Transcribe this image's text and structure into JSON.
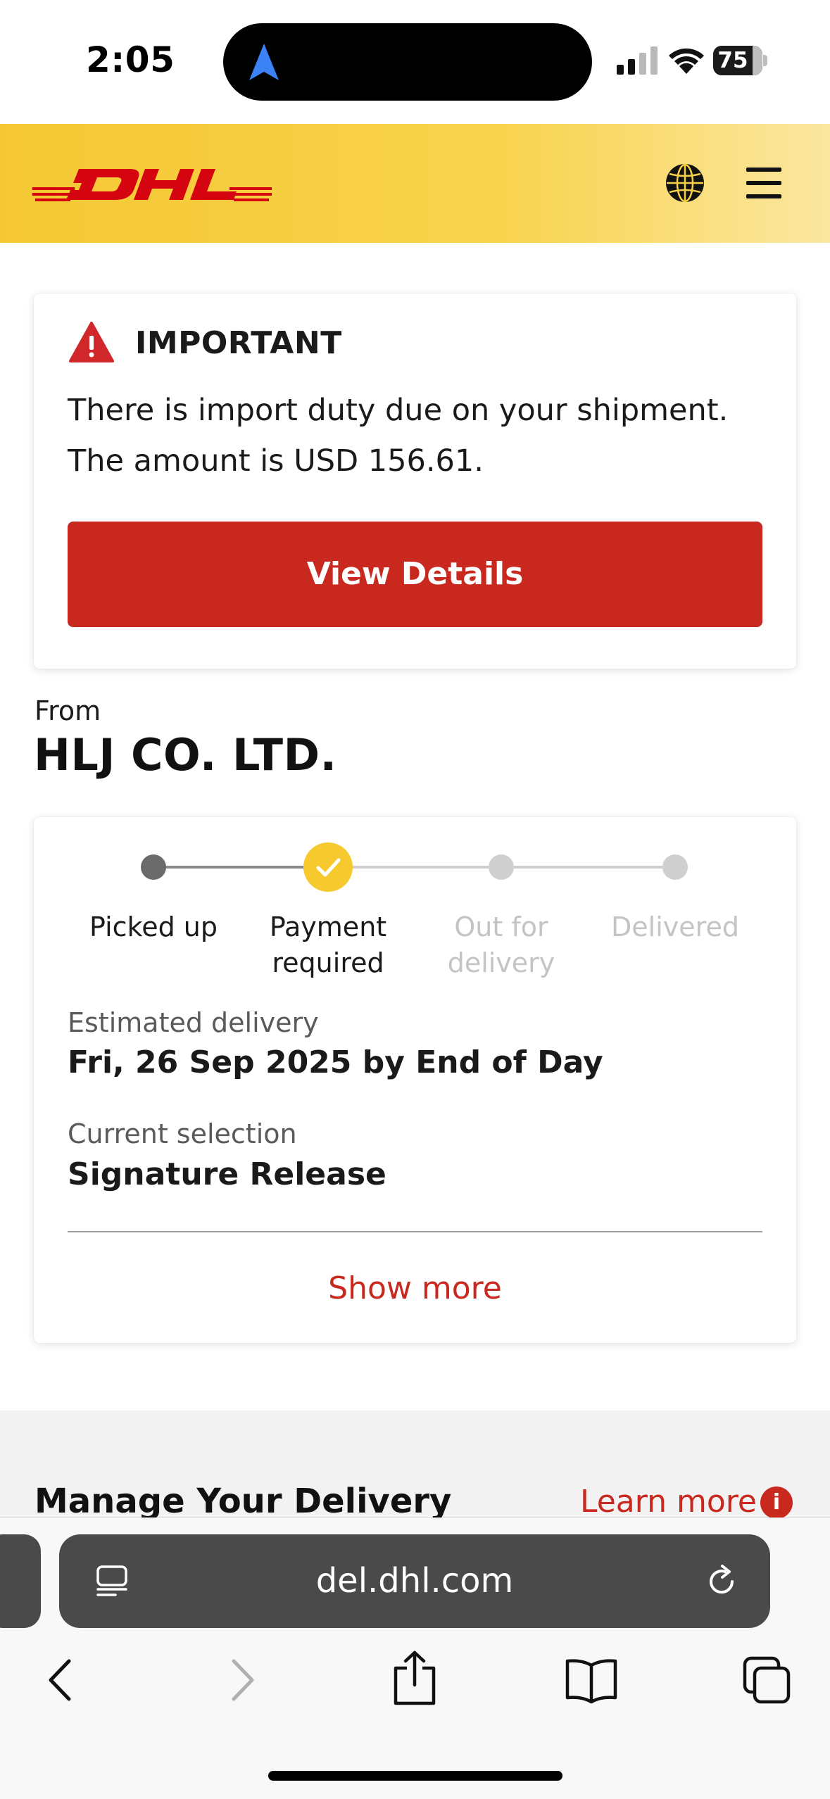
{
  "status_bar": {
    "time": "2:05",
    "battery_percent": "75",
    "battery_level": 0.75,
    "icons": [
      "navigation-arrow-icon",
      "cellular-signal-icon",
      "wifi-icon",
      "battery-icon"
    ]
  },
  "header": {
    "logo_text": "DHL",
    "brand_yellow": "#f5c833",
    "brand_red": "#c8281e",
    "icons": [
      "globe-icon",
      "menu-icon"
    ]
  },
  "alert": {
    "title": "IMPORTANT",
    "message": "There is import duty due on your shipment. The amount is USD 156.61.",
    "button_label": "View Details",
    "icon": "warning-icon"
  },
  "shipment": {
    "from_label": "From",
    "from_name": "HLJ CO. LTD."
  },
  "progress": {
    "steps": [
      {
        "label": "Picked up",
        "state": "completed"
      },
      {
        "label": "Payment required",
        "state": "current"
      },
      {
        "label": "Out for delivery",
        "state": "pending"
      },
      {
        "label": "Delivered",
        "state": "pending"
      }
    ],
    "estimated_delivery_label": "Estimated delivery",
    "estimated_delivery_value": "Fri, 26 Sep 2025 by End of Day",
    "current_selection_label": "Current selection",
    "current_selection_value": "Signature Release",
    "show_more_label": "Show more"
  },
  "manage": {
    "title": "Manage Your Delivery",
    "learn_more_label": "Learn more",
    "info_symbol": "i"
  },
  "browser": {
    "url": "del.dhl.com",
    "icons": [
      "reader-icon",
      "reload-icon",
      "back-icon",
      "forward-icon",
      "share-icon",
      "bookmarks-icon",
      "tabs-icon"
    ]
  }
}
